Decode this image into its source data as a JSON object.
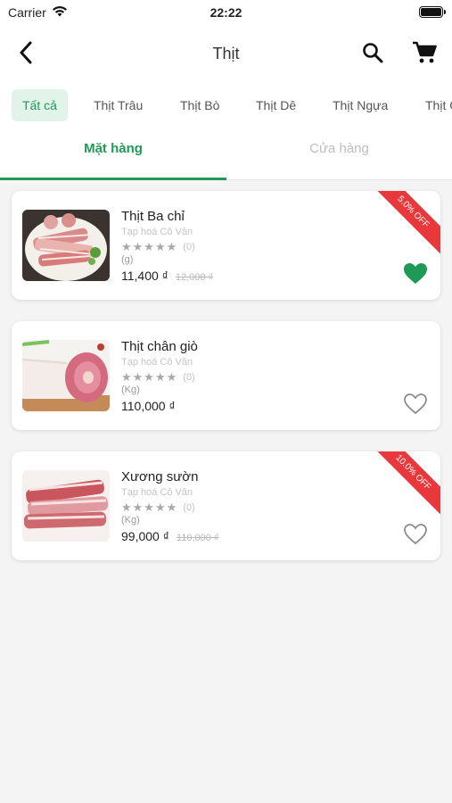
{
  "status": {
    "carrier": "Carrier",
    "time": "22:22"
  },
  "header": {
    "title": "Thịt"
  },
  "categories": [
    {
      "label": "Tất cả"
    },
    {
      "label": "Thịt Trâu"
    },
    {
      "label": "Thịt Bò"
    },
    {
      "label": "Thịt Dê"
    },
    {
      "label": "Thịt Ngựa"
    },
    {
      "label": "Thịt Gà"
    }
  ],
  "tabs": [
    {
      "label": "Mặt hàng"
    },
    {
      "label": "Cửa hàng"
    }
  ],
  "products": [
    {
      "name": "Thịt Ba chỉ",
      "store": "Tạp hoá Cô Vân",
      "stars": "★★★★★",
      "reviews": "(0)",
      "unit": "(g)",
      "price": "11,400 ₫",
      "old_price": "12,000 ₫",
      "badge": "5.0% OFF",
      "favorite": true
    },
    {
      "name": "Thịt chân giò",
      "store": "Tạp hoá Cô Vân",
      "stars": "★★★★★",
      "reviews": "(0)",
      "unit": "(Kg)",
      "price": "110,000 ₫",
      "old_price": "",
      "badge": "",
      "favorite": false
    },
    {
      "name": "Xương sườn",
      "store": "Tạp hoá Cô Vân",
      "stars": "★★★★★",
      "reviews": "(0)",
      "unit": "(Kg)",
      "price": "99,000 ₫",
      "old_price": "110,000 ₫",
      "badge": "10.0% OFF",
      "favorite": false
    }
  ],
  "colors": {
    "accent": "#1f9a55",
    "badge": "#e8383b",
    "chip_bg": "#e2f4ea"
  },
  "icons": {
    "back": "chevron-left-icon",
    "search": "search-icon",
    "cart": "cart-icon",
    "heart": "heart-icon"
  }
}
